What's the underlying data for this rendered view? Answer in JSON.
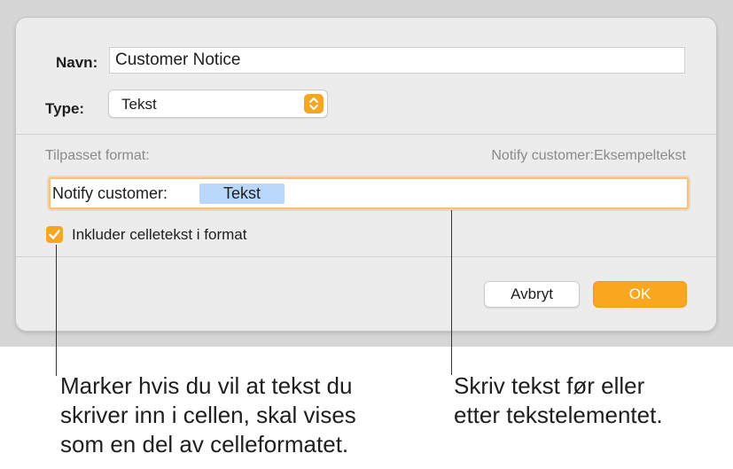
{
  "dialog": {
    "name_label": "Navn:",
    "name_value": "Customer Notice",
    "type_label": "Type:",
    "type_value": "Tekst",
    "custom_format_label": "Tilpasset format:",
    "preview_text": "Notify customer:Eksempeltekst",
    "format_prefix": "Notify customer:",
    "format_token": "Tekst",
    "include_checkbox_label": "Inkluder celletekst i format",
    "include_checked": true,
    "cancel_label": "Avbryt",
    "ok_label": "OK"
  },
  "callouts": {
    "left": [
      "Marker hvis du vil at tekst du",
      "skriver inn i cellen, skal vises",
      "som en del av celleformatet."
    ],
    "right": [
      "Skriv tekst før eller",
      "etter tekstelementet."
    ]
  },
  "colors": {
    "accent": "#f5a623",
    "token_bg": "#b9d7fb",
    "focus_ring": "#f4c27e"
  }
}
